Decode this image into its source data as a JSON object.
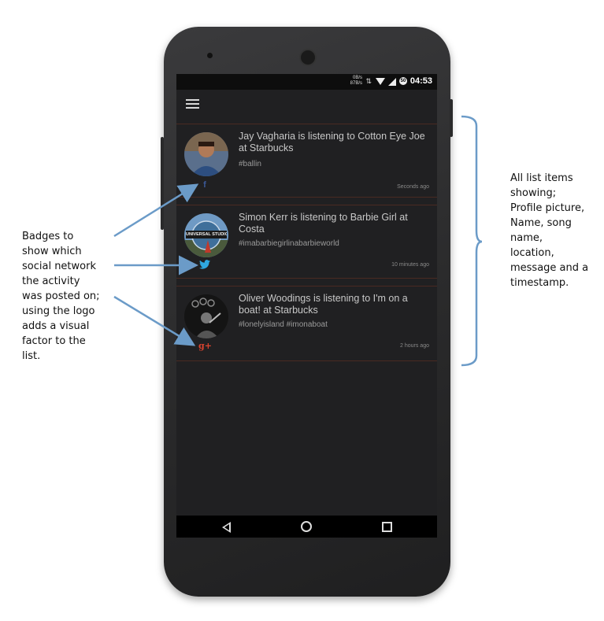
{
  "status_bar": {
    "net_down": "0B/s",
    "net_up": "87B/s",
    "battery_level": "50",
    "time": "04:53"
  },
  "toolbar": {
    "menu_icon": "hamburger-menu-icon"
  },
  "activity_list": [
    {
      "title": "Jay Vagharia is listening to Cotton Eye Joe at Starbucks",
      "tags": "#ballin",
      "timestamp": "Seconds ago",
      "network_badge": "f",
      "network_icon": "facebook-icon",
      "badge_color": "#3b5998"
    },
    {
      "title": "Simon Kerr is listening to Barbie Girl at Costa",
      "tags": "#imabarbiegirlinabarbieworld",
      "timestamp": "10 minutes ago",
      "network_badge": "twitter",
      "network_icon": "twitter-icon",
      "badge_color": "#2fa8e0"
    },
    {
      "title": "Oliver Woodings is listening to I'm on a boat! at Starbucks",
      "tags": "#lonelyisland #imonaboat",
      "timestamp": "2 hours ago",
      "network_badge": "g+",
      "network_icon": "google-plus-icon",
      "badge_color": "#d9432f"
    }
  ],
  "avatar_texts": {
    "item2_logo": "UNIVERSAL STUDIOS"
  },
  "annotations": {
    "left_lines": [
      "Badges to",
      "show which",
      "social network",
      "the activity",
      "was posted on;",
      "using the logo",
      "adds a visual",
      "factor to the",
      "list."
    ],
    "right_lines": [
      "All list items",
      "showing;",
      "Profile picture,",
      "Name, song",
      "name,",
      "location,",
      "message and a",
      "timestamp."
    ]
  },
  "colors": {
    "arrow": "#6b9bc8",
    "divider": "#4a2a22"
  }
}
